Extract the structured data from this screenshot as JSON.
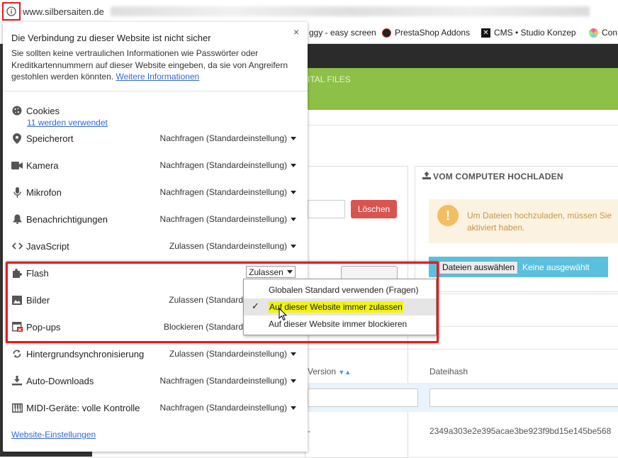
{
  "browser": {
    "url_text": "www.silbersaiten.de",
    "bookmarks": [
      {
        "label": "ggy - easy screen"
      },
      {
        "label": "PrestaShop Addons"
      },
      {
        "label": "CMS • Studio Konzep"
      },
      {
        "label": "Con"
      }
    ]
  },
  "page": {
    "green_bar_text": "ITAL FILES",
    "upload_title": "VOM COMPUTER HOCHLADEN",
    "warning_text": "Um Dateien hochzuladen, müssen Sie aktiviert haben.",
    "warning_icon": "!",
    "delete_button": "Löschen",
    "choose_file_button": "Dateien auswählen",
    "no_file_text": "Keine ausgewählt",
    "col_version": "Version",
    "col_dateihash": "Dateihash",
    "row_dash": "-",
    "row_hash": "2349a303e2e395acae3be923f9bd15e145be568"
  },
  "popup": {
    "title": "Die Verbindung zu dieser Website ist nicht sicher",
    "close": "×",
    "description": "Sie sollten keine vertraulichen Informationen wie Passwörter oder Kreditkartennummern auf dieser Website eingeben, da sie von Angreifern gestohlen werden könnten.",
    "more_info_link": "Weitere Informationen",
    "cookies_label": "Cookies",
    "cookies_link": "11 werden verwendet",
    "permissions": [
      {
        "label": "Speicherort",
        "value": "Nachfragen (Standardeinstellung)",
        "icon": "location-pin-icon"
      },
      {
        "label": "Kamera",
        "value": "Nachfragen (Standardeinstellung)",
        "icon": "camera-icon"
      },
      {
        "label": "Mikrofon",
        "value": "Nachfragen (Standardeinstellung)",
        "icon": "microphone-icon"
      },
      {
        "label": "Benachrichtigungen",
        "value": "Nachfragen (Standardeinstellung)",
        "icon": "bell-icon"
      },
      {
        "label": "JavaScript",
        "value": "Zulassen (Standardeinstellung)",
        "icon": "code-icon"
      },
      {
        "label": "Flash",
        "value": "Zulassen",
        "icon": "puzzle-icon"
      },
      {
        "label": "Bilder",
        "value": "Zulassen (Standard",
        "icon": "image-icon"
      },
      {
        "label": "Pop-ups",
        "value": "Blockieren (Standard",
        "icon": "popup-blocked-icon"
      },
      {
        "label": "Hintergrundsynchronisierung",
        "value": "Zulassen (Standardeinstellung)",
        "icon": "sync-icon"
      },
      {
        "label": "Auto-Downloads",
        "value": "Nachfragen (Standardeinstellung)",
        "icon": "download-icon"
      },
      {
        "label": "MIDI-Geräte: volle Kontrolle",
        "value": "Nachfragen (Standardeinstellung)",
        "icon": "midi-icon"
      }
    ],
    "site_settings_link": "Website-Einstellungen"
  },
  "dropdown": {
    "options": [
      {
        "label": "Globalen Standard verwenden (Fragen)",
        "selected": false
      },
      {
        "label": "Auf dieser Website immer zulassen",
        "selected": true
      },
      {
        "label": "Auf dieser Website immer blockieren",
        "selected": false
      }
    ],
    "check_mark": "✓"
  },
  "colors": {
    "highlight_frame": "#e01e1e",
    "highlight_text": "#f2f20f",
    "link": "#3367d6",
    "green_bar": "#8dc046",
    "danger_button": "#d9534f",
    "info_button": "#5bc0de"
  }
}
